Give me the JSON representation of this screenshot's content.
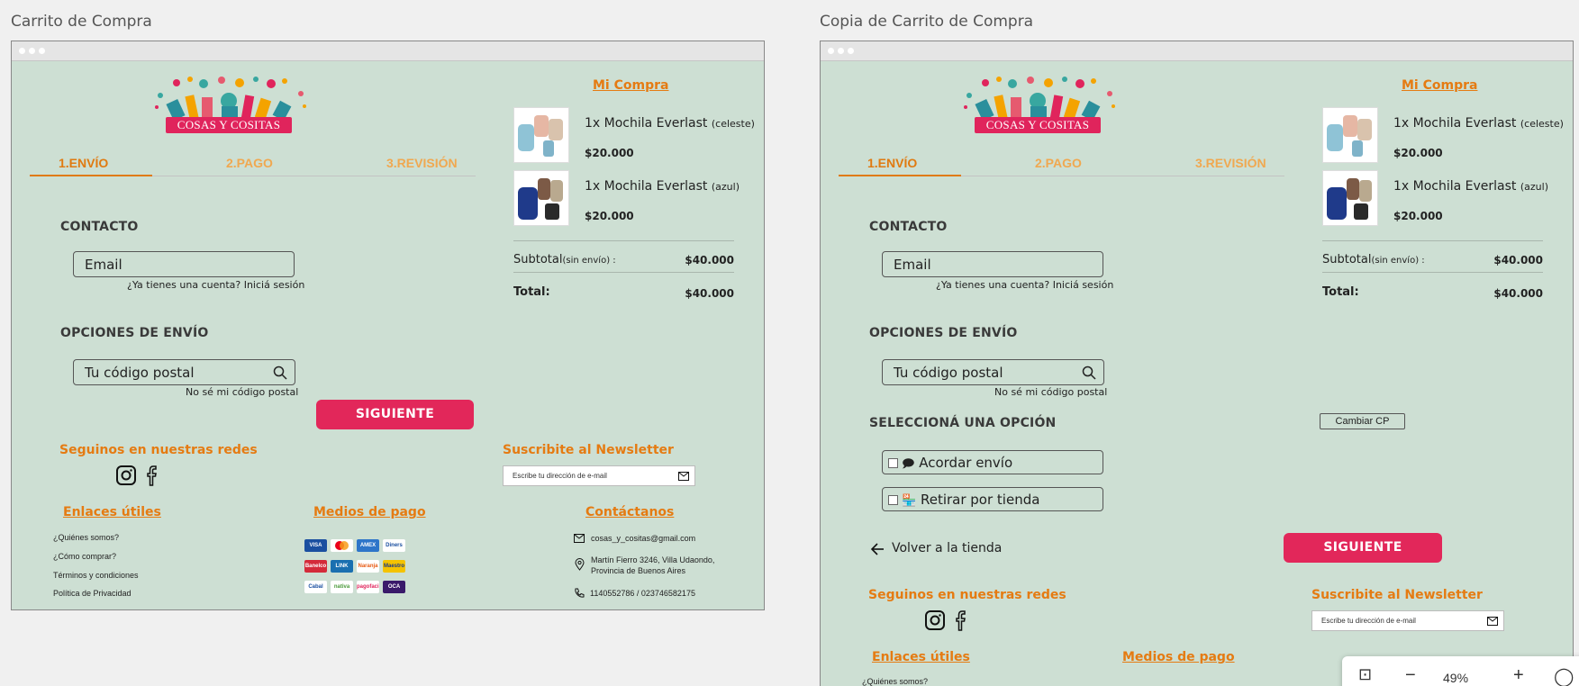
{
  "frames": [
    {
      "title": "Carrito de Compra",
      "brand": "COSAS Y COSITAS",
      "tabs": [
        "1.ENVÍO",
        "2.PAGO",
        "3.REVISIÓN"
      ],
      "contact_heading": "CONTACTO",
      "email_placeholder": "Email",
      "login_hint": "¿Ya tienes una cuenta? Iniciá sesión",
      "shipping_heading": "OPCIONES DE ENVÍO",
      "postal_placeholder": "Tu código postal",
      "postal_hint": "No sé mi código postal",
      "next_button": "SIGUIENTE",
      "cart": {
        "title": "Mi Compra",
        "items": [
          {
            "qty_name": "1x Mochila Everlast",
            "variant": "(celeste)",
            "price": "$20.000"
          },
          {
            "qty_name": "1x Mochila Everlast",
            "variant": "(azul)",
            "price": "$20.000"
          }
        ],
        "subtotal_label": "Subtotal",
        "subtotal_note": "(sin envío) :",
        "subtotal_value": "$40.000",
        "total_label": "Total:",
        "total_value": "$40.000"
      },
      "footer": {
        "social_heading": "Seguinos en nuestras redes",
        "newsletter_heading": "Suscribite al Newsletter",
        "newsletter_placeholder": "Escribe tu dirección de e-mail",
        "links_heading": "Enlaces útiles",
        "links": [
          "¿Quiénes somos?",
          "¿Cómo comprar?",
          "Términos y condiciones",
          "Política de Privacidad"
        ],
        "payments_heading": "Medios de pago",
        "payments": [
          "VISA",
          "MC",
          "AMEX",
          "Diners",
          "Banelco",
          "LINK",
          "Naranja",
          "Maestro",
          "Cabal",
          "nativa",
          "pagofacil",
          "OCA"
        ],
        "contact_heading": "Contáctanos",
        "email": "cosas_y_cositas@gmail.com",
        "address": [
          "Martín Fierro 3246, Villa Udaondo,",
          "Provincia de Buenos Aires"
        ],
        "phones": "1140552786 / 023746582175"
      }
    },
    {
      "title": "Copia de Carrito de Compra",
      "brand": "COSAS Y COSITAS",
      "tabs": [
        "1.ENVÍO",
        "2.PAGO",
        "3.REVISIÓN"
      ],
      "contact_heading": "CONTACTO",
      "email_placeholder": "Email",
      "login_hint": "¿Ya tienes una cuenta? Iniciá sesión",
      "shipping_heading": "OPCIONES DE ENVÍO",
      "postal_placeholder": "Tu código postal",
      "postal_hint": "No sé mi código postal",
      "select_heading": "SELECCIONÁ UNA OPCIÓN",
      "change_cp": "Cambiar CP",
      "options": [
        "Acordar envío",
        "Retirar por tienda"
      ],
      "back_link": "Volver a la tienda",
      "next_button": "SIGUIENTE",
      "cart": {
        "title": "Mi Compra",
        "items": [
          {
            "qty_name": "1x Mochila Everlast",
            "variant": "(celeste)",
            "price": "$20.000"
          },
          {
            "qty_name": "1x Mochila Everlast",
            "variant": "(azul)",
            "price": "$20.000"
          }
        ],
        "subtotal_label": "Subtotal",
        "subtotal_note": "(sin envío) :",
        "subtotal_value": "$40.000",
        "total_label": "Total:",
        "total_value": "$40.000"
      },
      "footer": {
        "social_heading": "Seguinos en nuestras redes",
        "newsletter_heading": "Suscribite al Newsletter",
        "newsletter_placeholder": "Escribe tu dirección de e-mail",
        "links_heading": "Enlaces útiles",
        "links_first": "¿Quiénes somos?",
        "payments_heading": "Medios de pago"
      }
    }
  ],
  "zoom": {
    "level": "49%"
  },
  "colors": {
    "bg": "#cddfd3",
    "accent": "#e57b12",
    "button": "#e2275a"
  }
}
